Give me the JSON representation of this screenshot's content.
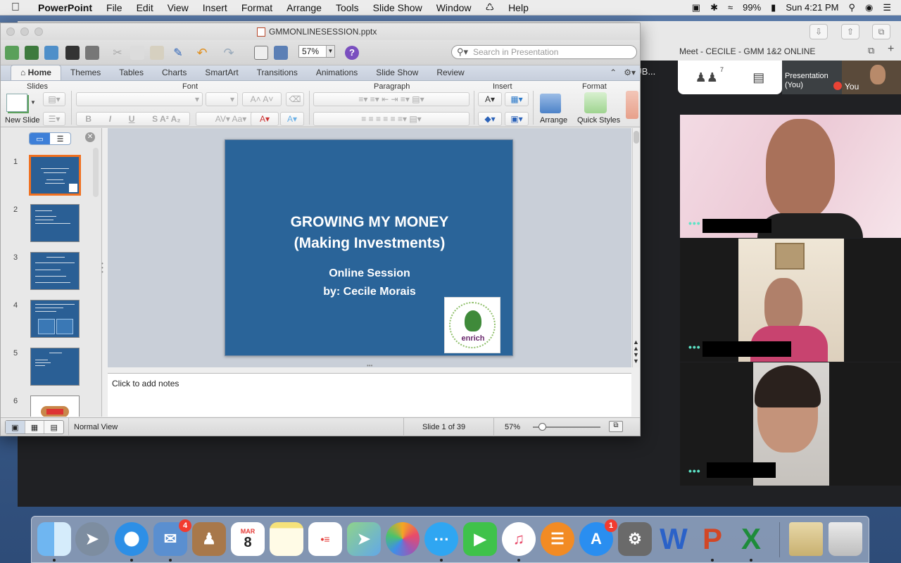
{
  "menubar": {
    "app_name": "PowerPoint",
    "items": [
      "File",
      "Edit",
      "View",
      "Insert",
      "Format",
      "Arrange",
      "Tools",
      "Slide Show",
      "Window",
      "Help"
    ],
    "battery": "99%",
    "clock": "Sun 4:21 PM"
  },
  "window": {
    "title": "GMMONLINESESSION.pptx"
  },
  "toolbar": {
    "zoom": "57%",
    "search_placeholder": "Search in Presentation"
  },
  "ribbon": {
    "tabs": [
      "Home",
      "Themes",
      "Tables",
      "Charts",
      "SmartArt",
      "Transitions",
      "Animations",
      "Slide Show",
      "Review"
    ],
    "groups": {
      "slides": "Slides",
      "font": "Font",
      "paragraph": "Paragraph",
      "insert": "Insert",
      "format": "Format"
    },
    "new_slide": "New Slide",
    "arrange": "Arrange",
    "quick_styles": "Quick Styles"
  },
  "sidebar": {
    "slides": [
      "1",
      "2",
      "3",
      "4",
      "5",
      "6"
    ]
  },
  "slide": {
    "title_line1": "GROWING MY MONEY",
    "title_line2": "(Making Investments)",
    "subtitle_line1": "Online Session",
    "subtitle_line2": "by: Cecile Morais",
    "logo_text": "enrich"
  },
  "notes": {
    "placeholder": "Click to add notes"
  },
  "status": {
    "view": "Normal View",
    "slide_count": "Slide 1 of 39",
    "zoom": "57%"
  },
  "meet": {
    "tab_title": "Meet - CECILE - GMM 1&2 ONLINE",
    "left_label": "RUB...",
    "participant_count": "7",
    "presentation_tile": "Presentation (You)",
    "you_label": "You",
    "tile_dots": "•••"
  },
  "dock": {
    "calendar_month": "MAR",
    "calendar_day": "8",
    "badges": {
      "mail": "4",
      "appstore": "1"
    }
  },
  "colors": {
    "slide_bg": "#2a6499",
    "accent": "#f07020",
    "meet_dots": "#5de3c6"
  }
}
